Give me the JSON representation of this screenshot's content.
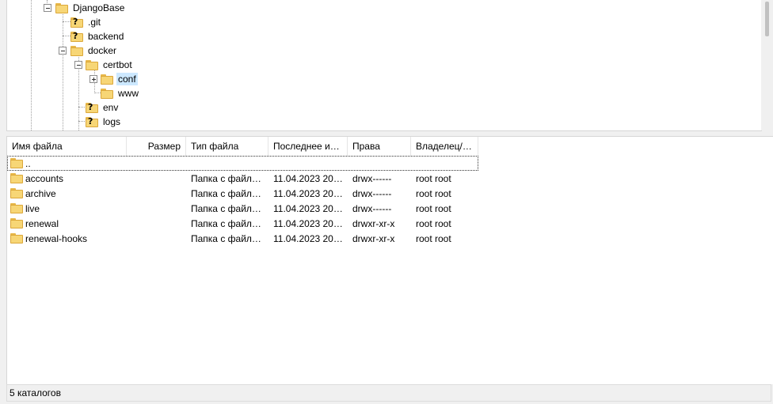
{
  "tree": {
    "nodes": [
      {
        "label": "DjangoBase",
        "unknown": false,
        "selected": false
      },
      {
        "label": ".git",
        "unknown": true,
        "selected": false
      },
      {
        "label": "backend",
        "unknown": true,
        "selected": false
      },
      {
        "label": "docker",
        "unknown": false,
        "selected": false
      },
      {
        "label": "certbot",
        "unknown": false,
        "selected": false
      },
      {
        "label": "conf",
        "unknown": false,
        "selected": true
      },
      {
        "label": "www",
        "unknown": false,
        "selected": false
      },
      {
        "label": "env",
        "unknown": true,
        "selected": false
      },
      {
        "label": "logs",
        "unknown": true,
        "selected": false
      }
    ]
  },
  "list": {
    "columns": {
      "name": "Имя файла",
      "size": "Размер",
      "type": "Тип файла",
      "modified": "Последнее из...",
      "perms": "Права",
      "owner": "Владелец/Г..."
    },
    "sort_indicator": "^",
    "parent_row": "..",
    "rows": [
      {
        "name": "accounts",
        "type": "Папка с файла...",
        "modified": "11.04.2023 20:4...",
        "perms": "drwx------",
        "owner": "root root"
      },
      {
        "name": "archive",
        "type": "Папка с файла...",
        "modified": "11.04.2023 20:4...",
        "perms": "drwx------",
        "owner": "root root"
      },
      {
        "name": "live",
        "type": "Папка с файла...",
        "modified": "11.04.2023 20:4...",
        "perms": "drwx------",
        "owner": "root root"
      },
      {
        "name": "renewal",
        "type": "Папка с файла...",
        "modified": "11.04.2023 20:4...",
        "perms": "drwxr-xr-x",
        "owner": "root root"
      },
      {
        "name": "renewal-hooks",
        "type": "Папка с файла...",
        "modified": "11.04.2023 20:4...",
        "perms": "drwxr-xr-x",
        "owner": "root root"
      }
    ]
  },
  "status": {
    "text": "5 каталогов"
  }
}
